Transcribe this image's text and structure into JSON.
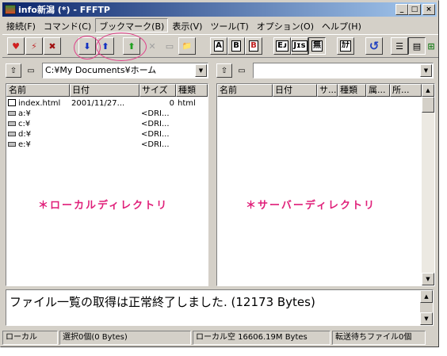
{
  "window": {
    "title": "info新潟 (*) - FFFTP"
  },
  "caption_buttons": {
    "minimize": "_",
    "maximize": "□",
    "close": "×"
  },
  "menu": [
    "接続(F)",
    "コマンド(C)",
    "ブックマーク(B)",
    "表示(V)",
    "ツール(T)",
    "オプション(O)",
    "ヘルプ(H)"
  ],
  "toolbar": {
    "connect_glyph": "♥",
    "quick_connect_glyph": "⚡",
    "disconnect_glyph": "✖",
    "download_glyph": "⬇",
    "upload_glyph": "⬆",
    "mirror_upload_glyph": "⬆",
    "delete_glyph": "✕",
    "rename_glyph": "▭",
    "mkdir_glyph": "📁",
    "ascii_label": "A",
    "binary_label": "B",
    "auto_label": "B",
    "kanji_euc_label": "Eᴊ",
    "kanji_jis_label": "Jɪs",
    "kanji_none_label": "無",
    "kana_label": "ｶﾅ",
    "refresh_glyph": "↺",
    "list_view_glyph": "☰",
    "detail_view_glyph": "▤",
    "tree_glyph": "⊞"
  },
  "local": {
    "path": "C:¥My Documents¥ホーム",
    "columns": [
      "名前",
      "日付",
      "サイズ",
      "種類"
    ],
    "files": [
      {
        "name": "index.html",
        "date": "2001/11/27...",
        "size": "0",
        "type": "html",
        "icon": "document-icon"
      },
      {
        "name": "a:¥",
        "date": "",
        "size": "<DRI...",
        "type": "",
        "icon": "drive-icon"
      },
      {
        "name": "c:¥",
        "date": "",
        "size": "<DRI...",
        "type": "",
        "icon": "drive-icon"
      },
      {
        "name": "d:¥",
        "date": "",
        "size": "<DRI...",
        "type": "",
        "icon": "drive-icon"
      },
      {
        "name": "e:¥",
        "date": "",
        "size": "<DRI...",
        "type": "",
        "icon": "drive-icon"
      }
    ],
    "annotation": "＊ローカルディレクトリ"
  },
  "remote": {
    "path": "",
    "columns": [
      "名前",
      "日付",
      "サ...",
      "種類",
      "属...",
      "所..."
    ],
    "annotation": "＊サーバーディレクトリ"
  },
  "log": {
    "message": "ファイル一覧の取得は正常終了しました. (12173 Bytes)"
  },
  "status": {
    "mode": "ローカル",
    "selection": "選択0個(0 Bytes)",
    "free_space": "ローカル空 16606.19M Bytes",
    "queue": "転送待ちファイル0個"
  },
  "colors": {
    "annotation": "#e0207a",
    "titlebar_start": "#0a246a",
    "titlebar_end": "#a6caf0"
  }
}
